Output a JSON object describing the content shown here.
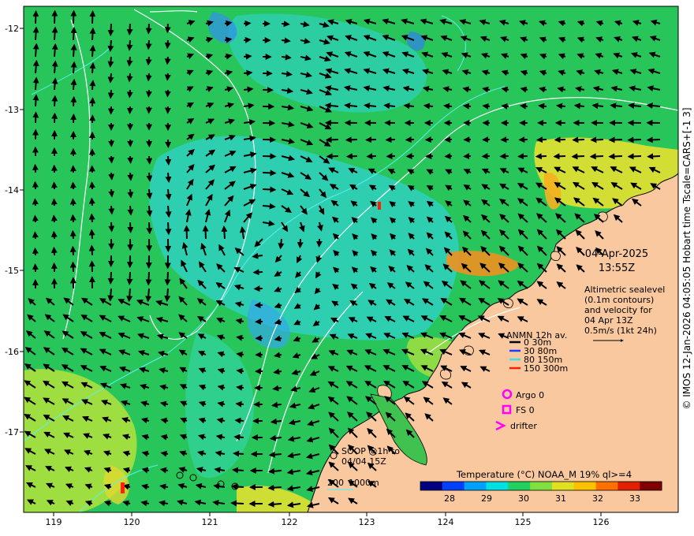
{
  "map": {
    "x_ticks": [
      "119",
      "120",
      "121",
      "122",
      "123",
      "124",
      "125",
      "126"
    ],
    "y_ticks": [
      "-12",
      "-13",
      "-14",
      "-15",
      "-16",
      "-17"
    ],
    "colors": {
      "land": "#f9c89e",
      "sea_green": "#2ec95a",
      "sea_cyan": "#2bd3c8",
      "sea_yellow": "#d8e83a",
      "contour": "#ffffff",
      "isobath": "#5cf0f0",
      "arrow": "#000000",
      "magenta": "#ff00ff"
    }
  },
  "info": {
    "date": "04-Apr-2025",
    "time": "13:55Z",
    "altimetry_lines": [
      "Altimetric sealevel",
      "(0.1m contours)",
      "and velocity for",
      "04 Apr 13Z",
      "0.5m/s (1kt 24h)"
    ]
  },
  "anmn": {
    "title": "ANMN 12h av.",
    "items": [
      {
        "label": "0 30m",
        "color": "#000000"
      },
      {
        "label": "30 80m",
        "color": "#1e3cff"
      },
      {
        "label": "80 150m",
        "color": "#40e0e0"
      },
      {
        "label": "150 300m",
        "color": "#ff2000"
      }
    ]
  },
  "markers": {
    "argo": "Argo 0",
    "fs": "FS 0",
    "drifter": "drifter"
  },
  "soop": {
    "line1": "SOOP @1h to",
    "line2": "04/04 15Z"
  },
  "isobaths": {
    "label1": "200",
    "label2": "1000m"
  },
  "colorbar": {
    "title": "Temperature (°C) NOAA_M 19% ql>=4",
    "ticks": [
      "28",
      "29",
      "30",
      "31",
      "32",
      "33"
    ],
    "colors": [
      "#000080",
      "#0040ff",
      "#00a0ff",
      "#00e0e0",
      "#20d060",
      "#80e040",
      "#e0e020",
      "#ffc000",
      "#ff7000",
      "#e02000",
      "#800000"
    ]
  },
  "credit": "© IMOS 12-Jan-2026 04:05:05 Hobart time Tscale=CARS+[-1 3]"
}
